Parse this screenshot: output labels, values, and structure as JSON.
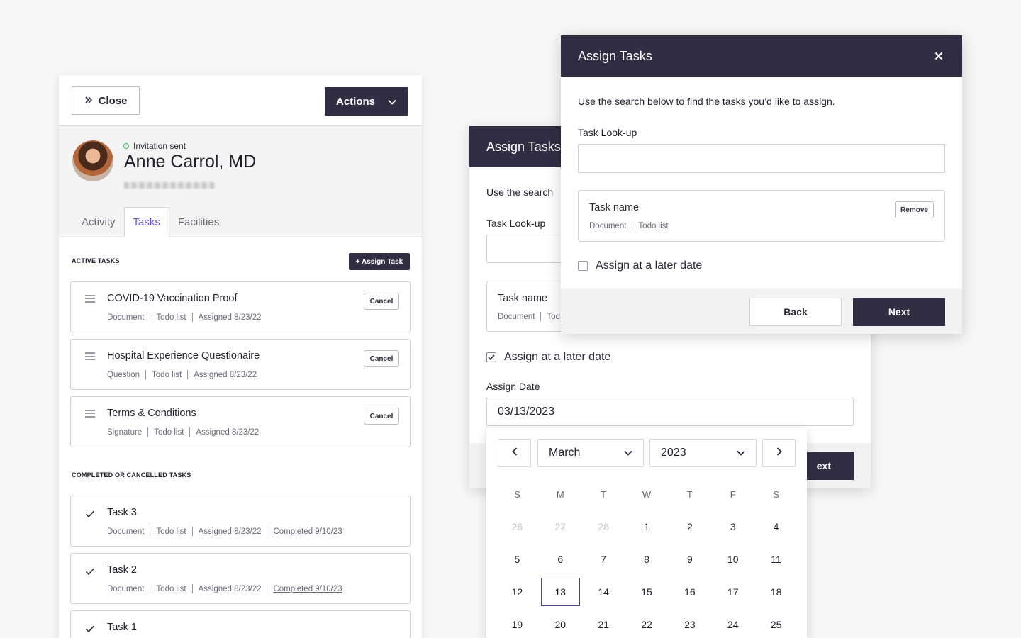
{
  "panel": {
    "close_label": "Close",
    "actions_label": "Actions",
    "status": "Invitation sent",
    "name": "Anne Carrol, MD",
    "tabs": [
      "Activity",
      "Tasks",
      "Facilities"
    ],
    "active_tasks_heading": "ACTIVE TASKS",
    "assign_task_label": "+ Assign Task",
    "completed_heading": "COMPLETED OR CANCELLED TASKS",
    "cancel_label": "Cancel",
    "active_tasks": [
      {
        "title": "COVID-19 Vaccination Proof",
        "type": "Document",
        "list": "Todo list",
        "assigned": "Assigned 8/23/22"
      },
      {
        "title": "Hospital Experience Questionaire",
        "type": "Question",
        "list": "Todo list",
        "assigned": "Assigned 8/23/22"
      },
      {
        "title": "Terms & Conditions",
        "type": "Signature",
        "list": "Todo list",
        "assigned": "Assigned 8/23/22"
      }
    ],
    "completed_tasks": [
      {
        "title": "Task 3",
        "type": "Document",
        "list": "Todo list",
        "assigned": "Assigned 8/23/22",
        "completed": "Completed 9/10/23"
      },
      {
        "title": "Task 2",
        "type": "Document",
        "list": "Todo list",
        "assigned": "Assigned 8/23/22",
        "completed": "Completed 9/10/23"
      },
      {
        "title": "Task 1"
      }
    ]
  },
  "modal_back": {
    "title": "Assign Tasks",
    "intro": "Use the search",
    "lookup_label": "Task Look-up",
    "card_title": "Task name",
    "card_type": "Document",
    "card_list": "Tod",
    "later_label": "Assign at a later date",
    "later_checked": true,
    "date_label": "Assign Date",
    "date_value": "03/13/2023",
    "next_label": "ext"
  },
  "calendar": {
    "month": "March",
    "year": "2023",
    "weekdays": [
      "S",
      "M",
      "T",
      "W",
      "T",
      "F",
      "S"
    ],
    "weeks": [
      [
        "26",
        "27",
        "28",
        "1",
        "2",
        "3",
        "4"
      ],
      [
        "5",
        "6",
        "7",
        "8",
        "9",
        "10",
        "11"
      ],
      [
        "12",
        "13",
        "14",
        "15",
        "16",
        "17",
        "18"
      ],
      [
        "19",
        "20",
        "21",
        "22",
        "23",
        "24",
        "25"
      ]
    ],
    "selected": "13"
  },
  "modal_front": {
    "title": "Assign Tasks",
    "intro": "Use the search below to find the tasks you’d like to assign.",
    "lookup_label": "Task Look-up",
    "lookup_value": "",
    "card_title": "Task name",
    "card_type": "Document",
    "card_list": "Todo list",
    "remove_label": "Remove",
    "later_label": "Assign at a later date",
    "later_checked": false,
    "back_label": "Back",
    "next_label": "Next"
  },
  "colors": {
    "brand_dark": "#312e43",
    "accent_tab": "#6a4fd6",
    "status_dot": "#3bb36a"
  }
}
